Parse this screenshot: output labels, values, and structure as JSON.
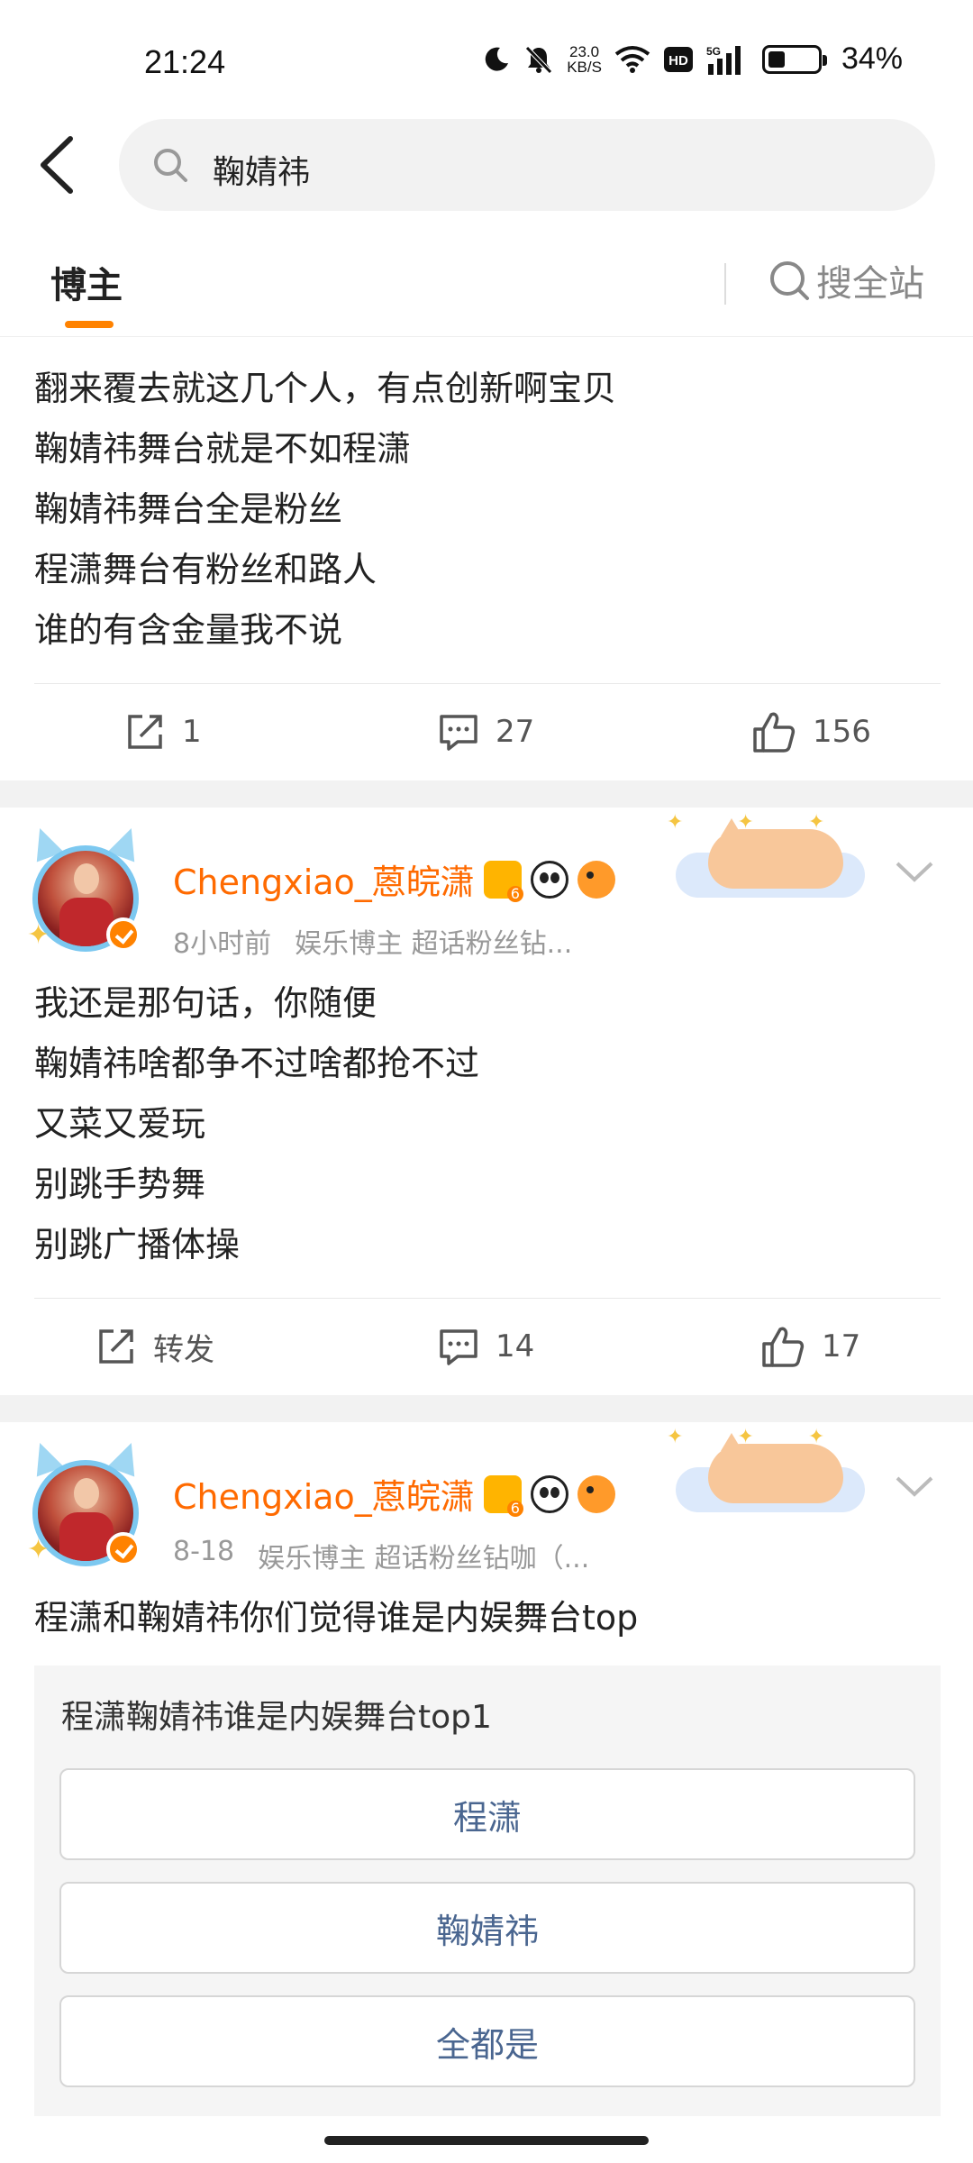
{
  "status_bar": {
    "time": "21:24",
    "net_speed_value": "23.0",
    "net_speed_unit": "KB/S",
    "hd_label": "HD",
    "signal_label": "5G",
    "battery_percent": "34%",
    "battery_level": 0.34,
    "icons": [
      "moon-icon",
      "mute-bell-icon",
      "wifi-icon",
      "hd-icon",
      "signal-icon",
      "battery-icon"
    ]
  },
  "search": {
    "query": "鞠婧祎"
  },
  "tabs": {
    "active": "博主",
    "search_all": "搜全站"
  },
  "posts": [
    {
      "lines": [
        "翻来覆去就这几个人，有点创新啊宝贝",
        "鞠婧祎舞台就是不如程潇",
        "鞠婧祎舞台全是粉丝",
        "程潇舞台有粉丝和路人",
        "谁的有含金量我不说"
      ],
      "repost": "1",
      "comments": "27",
      "likes": "156"
    },
    {
      "username": "Chengxiao_蒽皖潇",
      "time": "8小时前",
      "tags": "娱乐博主 超话粉丝钻...",
      "lines": [
        "我还是那句话，你随便",
        "鞠婧祎啥都争不过啥都抢不过",
        "又菜又爱玩",
        "别跳手势舞",
        "别跳广播体操"
      ],
      "repost": "转发",
      "comments": "14",
      "likes": "17"
    },
    {
      "username": "Chengxiao_蒽皖潇",
      "time": "8-18",
      "tags": "娱乐博主 超话粉丝钻咖（...",
      "text": "程潇和鞠婧祎你们觉得谁是内娱舞台top",
      "poll": {
        "title": "程潇鞠婧祎谁是内娱舞台top1",
        "options": [
          "程潇",
          "鞠婧祎",
          "全都是"
        ]
      }
    }
  ],
  "colors": {
    "accent": "#ff8200",
    "username": "#ff6a00",
    "poll_option_text": "#4a6690",
    "separator": "#f2f2f2"
  }
}
